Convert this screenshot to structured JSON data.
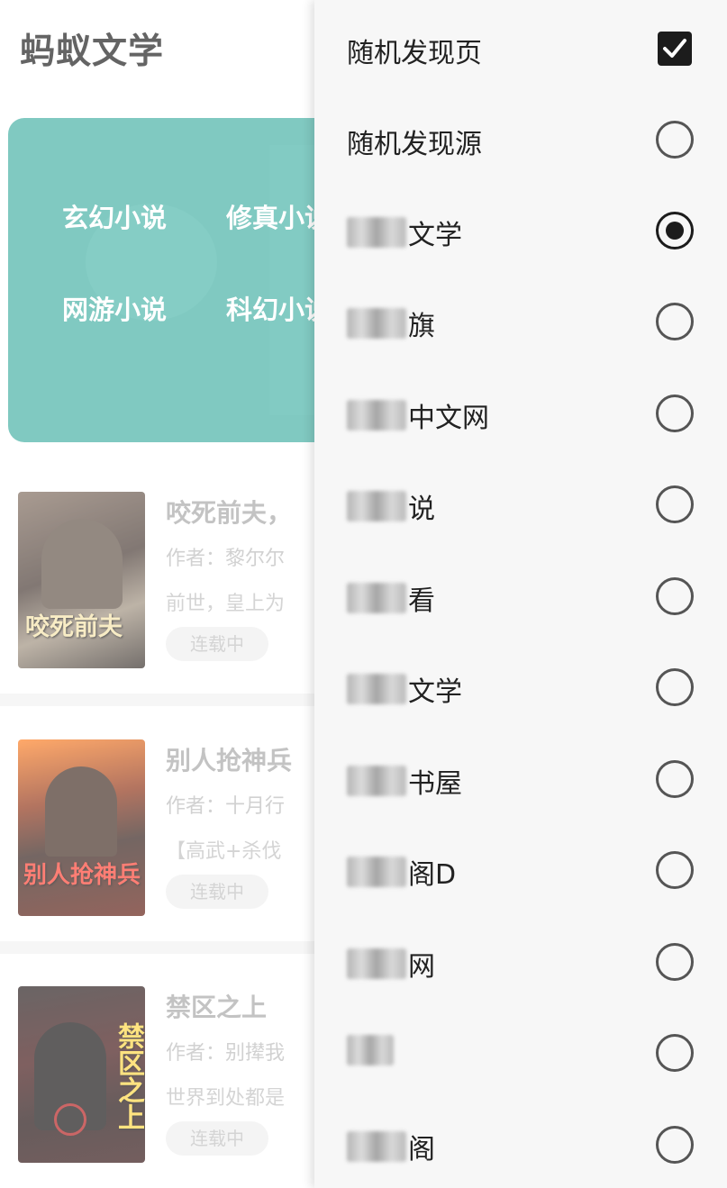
{
  "app": {
    "title": "蚂蚁文学",
    "categories": [
      "玄幻小说",
      "修真小说",
      "网游小说",
      "科幻小说"
    ]
  },
  "books": [
    {
      "title": "咬死前夫，",
      "author": "作者：黎尔尔",
      "desc": "前世，皇上为",
      "status": "连载中",
      "cover_text": "咬死前夫"
    },
    {
      "title": "别人抢神兵",
      "author": "作者：十月行",
      "desc": "【高武+杀伐",
      "status": "连载中",
      "cover_text": "别人抢神兵"
    },
    {
      "title": "禁区之上",
      "author": "作者：别撵我",
      "desc": "世界到处都是",
      "status": "连载中",
      "cover_text": "禁区之上"
    }
  ],
  "menu": {
    "items": [
      {
        "label": "随机发现页",
        "control": "checkbox",
        "checked": true
      },
      {
        "label": "随机发现源",
        "control": "radio",
        "checked": false
      },
      {
        "label": "文学",
        "control": "radio",
        "checked": true,
        "masked": true
      },
      {
        "label": "旗",
        "control": "radio",
        "checked": false,
        "masked": true
      },
      {
        "label": "中文网",
        "control": "radio",
        "checked": false,
        "masked": true
      },
      {
        "label": "说",
        "control": "radio",
        "checked": false,
        "masked": true
      },
      {
        "label": "看",
        "control": "radio",
        "checked": false,
        "masked": true
      },
      {
        "label": "文学",
        "control": "radio",
        "checked": false,
        "masked": true
      },
      {
        "label": "书屋",
        "control": "radio",
        "checked": false,
        "masked": true
      },
      {
        "label": "阁D",
        "control": "radio",
        "checked": false,
        "masked": true
      },
      {
        "label": "网",
        "control": "radio",
        "checked": false,
        "masked": true
      },
      {
        "label": "",
        "control": "radio",
        "checked": false,
        "masked": true
      },
      {
        "label": "阁",
        "control": "radio",
        "checked": false,
        "masked": true
      }
    ]
  },
  "colors": {
    "banner": "#3dada0",
    "menu_bg": "#f7f7f7",
    "control": "#1c1c1c"
  }
}
